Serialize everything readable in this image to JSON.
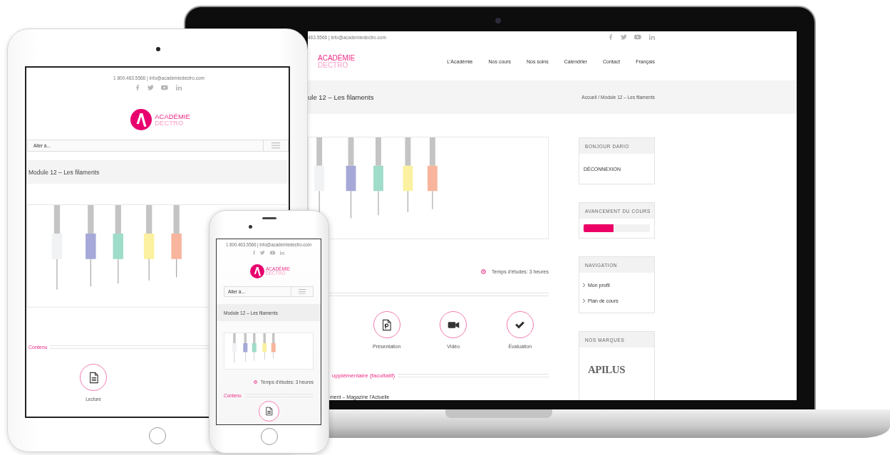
{
  "laptop": {
    "contact": "463.5566 | info@academiedectro.com",
    "logo": {
      "line_1": "ACADÉMIE",
      "line_2": "DECTRO"
    },
    "nav": [
      "L'Académie",
      "Nos cours",
      "Nos soins",
      "Calendrier",
      "Contact",
      "Français"
    ],
    "page_title": "ule 12 – Les filaments",
    "breadcrumb": [
      "Accueil",
      "/",
      "Module 12 – Les filaments"
    ],
    "banner": {
      "kind": "picture"
    },
    "study_time": "Temps d'études: 3 heures",
    "activities": [
      {
        "kind": "presentation",
        "label": "Présentation"
      },
      {
        "kind": "video",
        "label": "Vidéo"
      },
      {
        "kind": "check",
        "label": "Évaluation"
      }
    ],
    "section_heading": "upplémentaire (facultatif)",
    "resource": "ment – Magazine l'Actuelle",
    "sidebar": [
      {
        "kind": "links",
        "title": "BONJOUR DARIO",
        "items": [
          "DÉCONNEXION"
        ]
      },
      {
        "kind": "progress",
        "title": "AVANCEMENT DU COURS",
        "level": 0.45
      },
      {
        "kind": "nav",
        "title": "NAVIGATION",
        "items": [
          "Mon profil",
          "Plan de cours"
        ]
      },
      {
        "kind": "brands",
        "title": "NOS MARQUES",
        "brand": "APILUS"
      }
    ]
  },
  "tablet": {
    "contact": "1 800.463.5566 | info@academiedectro.com",
    "logo": {
      "line_1": "ACADÉMIE",
      "line_2": "DECTRO"
    },
    "menu": {
      "placeholder": "Aller à..."
    },
    "page_title": "Module 12 – Les filaments",
    "banner": {
      "kind": "picture"
    },
    "section_heading": "Contenu",
    "activities": [
      {
        "kind": "document",
        "label": "Lecture"
      }
    ]
  },
  "phone": {
    "contact": "1 800.463.5566 | info@academiedectro.com",
    "logo": {
      "line_1": "ACADÉMIE",
      "line_2": "DECTRO"
    },
    "menu": {
      "placeholder": "Aller à..."
    },
    "page_title": "Module 12 – Les filaments",
    "banner": {
      "kind": "picture"
    },
    "study_time": "Temps d'études: 3 heures",
    "section_heading": "Contenu",
    "activities": [
      {
        "kind": "document"
      }
    ]
  }
}
